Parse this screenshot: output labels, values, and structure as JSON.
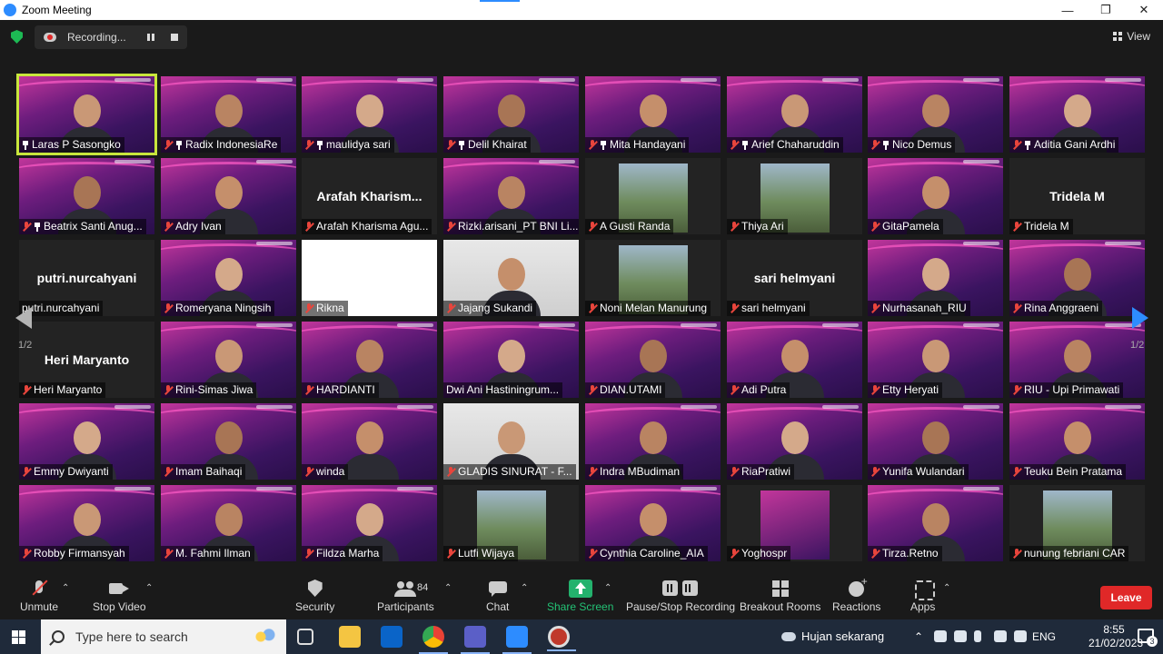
{
  "window": {
    "title": "Zoom Meeting"
  },
  "topbar": {
    "recording_label": "Recording...",
    "view_label": "View"
  },
  "pagination": {
    "left": "1/2",
    "right": "1/2"
  },
  "participants_tiles": [
    {
      "label": "Laras P Sasongko",
      "type": "video",
      "pinned": true,
      "muted": false,
      "active": true
    },
    {
      "label": "Radix IndonesiaRe",
      "type": "video",
      "pinned": true,
      "muted": true
    },
    {
      "label": "maulidya sari",
      "type": "video",
      "pinned": true,
      "muted": true
    },
    {
      "label": "Delil Khairat",
      "type": "video",
      "pinned": true,
      "muted": true
    },
    {
      "label": "Mita Handayani",
      "type": "video",
      "pinned": true,
      "muted": true
    },
    {
      "label": "Arief Chaharuddin",
      "type": "video",
      "pinned": true,
      "muted": true
    },
    {
      "label": "Nico Demus",
      "type": "video",
      "pinned": true,
      "muted": true
    },
    {
      "label": "Aditia Gani Ardhi",
      "type": "video",
      "pinned": true,
      "muted": true
    },
    {
      "label": "Beatrix Santi Anug...",
      "type": "video",
      "pinned": true,
      "muted": true
    },
    {
      "label": "Adry Ivan",
      "type": "video",
      "pinned": false,
      "muted": true
    },
    {
      "label": "Arafah Kharisma Agu...",
      "type": "name",
      "center_name": "Arafah Kharism...",
      "muted": true
    },
    {
      "label": "Rizki.arisani_PT BNI Li...",
      "type": "video",
      "muted": true
    },
    {
      "label": "A Gusti Randa",
      "type": "photo",
      "muted": true
    },
    {
      "label": "Thiya Ari",
      "type": "photo",
      "muted": true
    },
    {
      "label": "GitaPamela",
      "type": "video",
      "muted": true
    },
    {
      "label": "Tridela M",
      "type": "name",
      "center_name": "Tridela M",
      "muted": true
    },
    {
      "label": "putri.nurcahyani",
      "type": "name",
      "center_name": "putri.nurcahyani",
      "muted": false
    },
    {
      "label": "Romeryana Ningsih",
      "type": "video",
      "muted": true
    },
    {
      "label": "Rikna",
      "type": "white",
      "muted": true
    },
    {
      "label": "Jajang Sukandi",
      "type": "photo-full",
      "muted": true
    },
    {
      "label": "Noni Melan Manurung",
      "type": "photo",
      "muted": true
    },
    {
      "label": "sari helmyani",
      "type": "name",
      "center_name": "sari helmyani",
      "muted": true
    },
    {
      "label": "Nurhasanah_RIU",
      "type": "video",
      "muted": true
    },
    {
      "label": "Rina Anggraeni",
      "type": "video",
      "muted": true
    },
    {
      "label": "Heri Maryanto",
      "type": "name",
      "center_name": "Heri Maryanto",
      "muted": true
    },
    {
      "label": "Rini-Simas Jiwa",
      "type": "video",
      "muted": true
    },
    {
      "label": "HARDIANTI",
      "type": "video",
      "muted": true
    },
    {
      "label": "Dwi Ani Hastiningrum...",
      "type": "video",
      "muted": false
    },
    {
      "label": "DIAN.UTAMI",
      "type": "video",
      "muted": true
    },
    {
      "label": "Adi Putra",
      "type": "video",
      "muted": true
    },
    {
      "label": "Etty Heryati",
      "type": "video",
      "muted": true
    },
    {
      "label": "RIU - Upi Primawati",
      "type": "video",
      "muted": true
    },
    {
      "label": "Emmy Dwiyanti",
      "type": "video",
      "muted": true
    },
    {
      "label": "Imam Baihaqi",
      "type": "video",
      "muted": true
    },
    {
      "label": "winda",
      "type": "video",
      "muted": true
    },
    {
      "label": "GLADIS SINURAT - F...",
      "type": "photo-full",
      "muted": true
    },
    {
      "label": "Indra MBudiman",
      "type": "video",
      "muted": true
    },
    {
      "label": "RiaPratiwi",
      "type": "video",
      "muted": true
    },
    {
      "label": "Yunifa Wulandari",
      "type": "video",
      "muted": true
    },
    {
      "label": "Teuku Bein Pratama",
      "type": "video",
      "muted": true
    },
    {
      "label": "Robby Firmansyah",
      "type": "video",
      "muted": true
    },
    {
      "label": "M. Fahmi Ilman",
      "type": "video",
      "muted": true
    },
    {
      "label": "Fildza Marha",
      "type": "video",
      "muted": true
    },
    {
      "label": "Lutfi Wijaya",
      "type": "photo",
      "muted": true
    },
    {
      "label": "Cynthia Caroline_AIA",
      "type": "video",
      "muted": true
    },
    {
      "label": "Yoghospr",
      "type": "photo-dark",
      "muted": true
    },
    {
      "label": "Tirza.Retno",
      "type": "video",
      "muted": true
    },
    {
      "label": "nunung febriani CAR",
      "type": "photo",
      "muted": true
    }
  ],
  "toolbar": {
    "unmute": "Unmute",
    "stop_video": "Stop Video",
    "security": "Security",
    "participants": "Participants",
    "participants_count": "84",
    "chat": "Chat",
    "share_screen": "Share Screen",
    "pause_stop": "Pause/Stop Recording",
    "breakout": "Breakout Rooms",
    "reactions": "Reactions",
    "apps": "Apps",
    "leave": "Leave"
  },
  "taskbar": {
    "search_placeholder": "Type here to search",
    "weather": "Hujan sekarang",
    "language": "ENG",
    "time": "8:55",
    "date": "21/02/2023",
    "notification_count": "3"
  },
  "colors": {
    "zoom_blue": "#2d8cff",
    "share_green": "#23b26d",
    "leave_red": "#e02828",
    "active_speaker": "#c8e63c"
  }
}
